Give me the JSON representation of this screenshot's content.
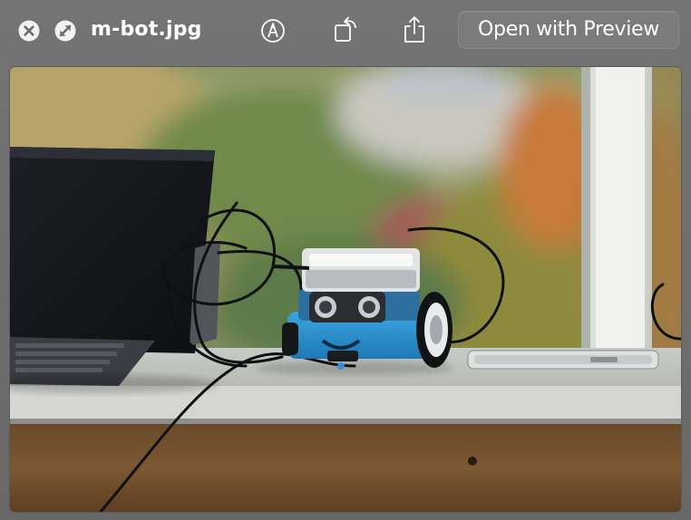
{
  "window": {
    "filename": "m-bot.jpg",
    "open_button_label": "Open with Preview"
  },
  "toolbar": {
    "icons": [
      "close-icon",
      "fullscreen-icon",
      "markup-icon",
      "rotate-icon",
      "share-icon"
    ]
  },
  "image": {
    "name": "m-bot.jpg",
    "subject": "robot-photo"
  }
}
